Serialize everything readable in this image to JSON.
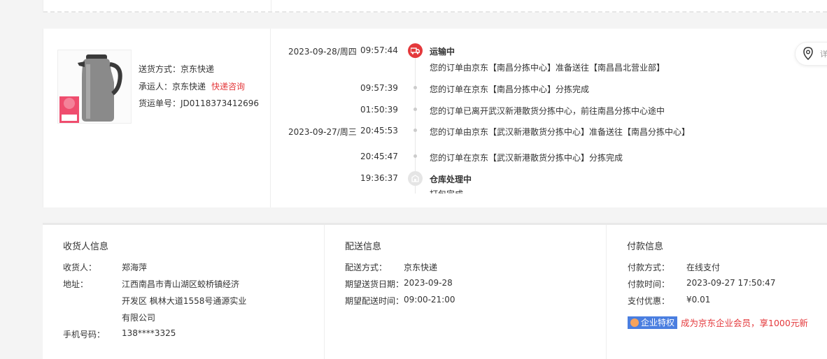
{
  "shipment": {
    "delivery_method_label": "送货方式：",
    "delivery_method": "京东快递",
    "carrier_label": "承运人：",
    "carrier": "京东快递",
    "carrier_link": "快递咨询",
    "tracking_label": "货运单号：",
    "tracking_no": "JD0118373412696",
    "map_button_label": "详"
  },
  "timeline": [
    {
      "date": "2023-09-28/周四",
      "time": "09:57:44",
      "status": "运输中",
      "text": "您的订单由京东【南昌分拣中心】准备送往【南昌昌北营业部】"
    },
    {
      "date": "",
      "time": "09:57:39",
      "text": "您的订单在京东【南昌分拣中心】分拣完成"
    },
    {
      "date": "",
      "time": "01:50:39",
      "text": "您的订单已离开武汉新港散货分拣中心，前往南昌分拣中心途中"
    },
    {
      "date": "2023-09-27/周三",
      "time": "20:45:53",
      "text": "您的订单由京东【武汉新港散货分拣中心】准备送往【南昌分拣中心】"
    },
    {
      "date": "",
      "time": "20:45:47",
      "text": "您的订单在京东【武汉新港散货分拣中心】分拣完成"
    },
    {
      "date": "",
      "time": "19:36:37",
      "status": "仓库处理中",
      "text": "打包完成"
    }
  ],
  "receiver": {
    "title": "收货人信息",
    "name_label": "收货人：",
    "name": "郑海萍",
    "address_label": "地址：",
    "address_line1": "江西南昌市青山湖区蛟桥镇经济",
    "address_line2": "开发区 枫林大道1558号通源实业",
    "address_line3": "有限公司",
    "phone_label": "手机号码：",
    "phone": "138****3325"
  },
  "delivery": {
    "title": "配送信息",
    "method_label": "配送方式：",
    "method": "京东快递",
    "date_label": "期望送货日期：",
    "date": "2023-09-28",
    "time_label": "期望配送时间：",
    "time": "09:00-21:00"
  },
  "payment": {
    "title": "付款信息",
    "method_label": "付款方式：",
    "method": "在线支付",
    "time_label": "付款时间：",
    "time": "2023-09-27 17:50:47",
    "discount_label": "支付优惠：",
    "discount": "¥0.01",
    "promo_badge": "企业特权",
    "promo_text": "成为京东企业会员，享1000元新"
  },
  "colors": {
    "accent": "#e4393c",
    "promo_blue": "#4a7ee0"
  },
  "icons": {
    "transit": "transit-icon",
    "warehouse": "warehouse-icon",
    "map": "location-pin-icon"
  }
}
